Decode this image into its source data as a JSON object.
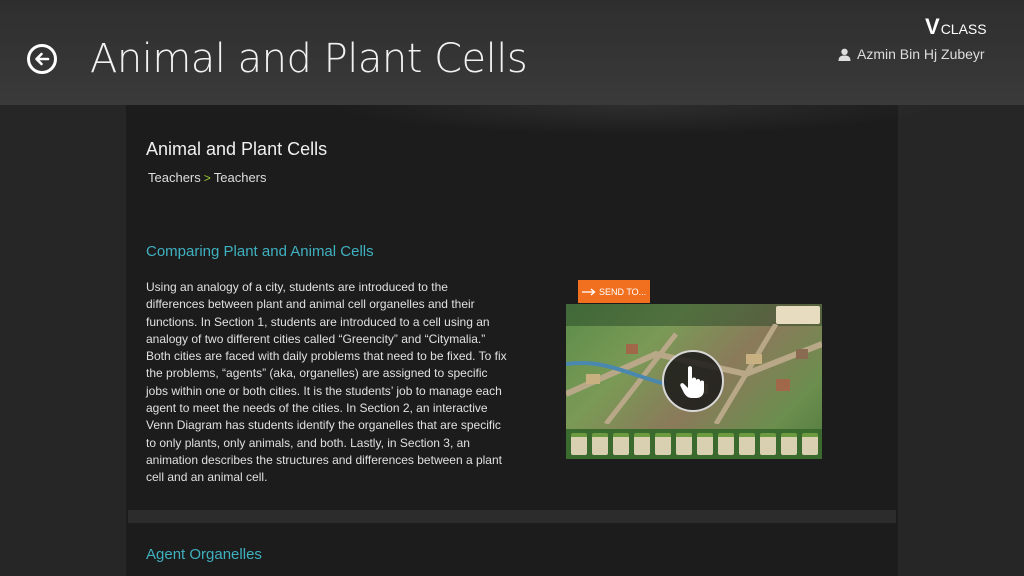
{
  "header": {
    "title": "Animal and Plant Cells",
    "brand_v": "V",
    "brand_text": "CLASS",
    "user_name": "Azmin Bin Hj Zubeyr"
  },
  "content": {
    "title": "Animal and Plant Cells",
    "breadcrumb": [
      "Teachers",
      "Teachers"
    ],
    "breadcrumb_separator": ">",
    "sections": [
      {
        "title": "Comparing Plant and Animal Cells",
        "description": "Using an analogy of a city, students are introduced to the differences between plant and animal cell organelles and their functions. In Section 1, students are introduced to a cell using an analogy of two different cities called “Greencity” and “Citymalia.” Both cities are faced with daily problems that need to be fixed. To fix the problems, “agents” (aka, organelles) are assigned to specific jobs within one or both cities. It is the students’ job to manage each agent to meet the needs of the cities. In Section 2, an interactive Venn Diagram has students identify the organelles that are specific to only plants, only animals, and both. Lastly, in Section 3, an animation describes the structures and differences between a plant cell and an animal cell.",
        "send_label": "SEND TO...",
        "thumbnail_icon": "hand-pointer-icon"
      },
      {
        "title": "Agent Organelles"
      }
    ]
  },
  "colors": {
    "accent": "#3fb0c0",
    "send_button": "#f07020",
    "breadcrumb_separator": "#9acd32"
  }
}
